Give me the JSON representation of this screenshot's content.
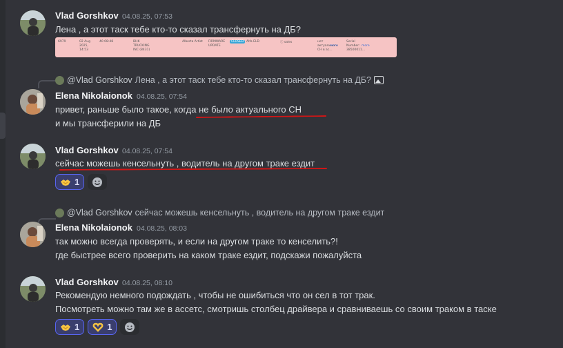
{
  "messages": [
    {
      "author": "Vlad Gorshkov",
      "timestamp": "04.08.25, 07:53",
      "lines": [
        "Лена , а этот таск тебе кто-то сказал трансфернуть на ДБ?"
      ],
      "embed": {
        "cells": [
          "6979",
          "02 Aug 2025, 14:53",
          "40 08:48",
          "BHK TRUCKING INC (8431)",
          "Alberta Artist",
          "FIRMWARE UPDATE",
          "CLOSED",
          "Alfa ELD",
          "ⓘ sales",
          "нет актуального CH в ас...",
          "more",
          "Serial Number: 38500011...",
          "more"
        ]
      }
    },
    {
      "reply_author": "@Vlad Gorshkov",
      "reply_text": "Лена , а этот таск тебе кто-то сказал трансфернуть на ДБ?",
      "author": "Elena Nikolaionok",
      "timestamp": "04.08.25, 07:54",
      "lines": [
        "привет, раньше было такое, когда не было актуального СН",
        "и мы трансферили на ДБ"
      ]
    },
    {
      "author": "Vlad Gorshkov",
      "timestamp": "04.08.25, 07:54",
      "lines": [
        "сейчас можешь кенсельнуть , водитель на другом траке ездит"
      ],
      "reactions": [
        {
          "emoji": "handshake-emoji",
          "count": "1"
        }
      ]
    },
    {
      "reply_author": "@Vlad Gorshkov",
      "reply_text": "сейчас можешь кенсельнуть , водитель на другом траке ездит",
      "author": "Elena Nikolaionok",
      "timestamp": "04.08.25, 08:03",
      "lines": [
        "так можно всегда проверять, и если на другом траке то кенселить?!",
        "где быстрее всего проверить на каком траке ездит, подскажи пожалуйста"
      ]
    },
    {
      "author": "Vlad Gorshkov",
      "timestamp": "04.08.25, 08:10",
      "lines": [
        "Рекомендую немного подождать , чтобы не ошибиться что он сел в тот трак.",
        "Посмотреть можно там же в ассетс, смотришь столбец драйвера и сравниваешь со своим траком в таске"
      ],
      "reactions": [
        {
          "emoji": "handshake-emoji",
          "count": "1"
        },
        {
          "emoji": "heart-hands-emoji",
          "count": "1"
        }
      ]
    }
  ],
  "colors": {
    "background": "#323339",
    "annotation_underline": "#d41515",
    "reaction_accent": "#5865f2",
    "embed_background": "#f6c4c4"
  }
}
